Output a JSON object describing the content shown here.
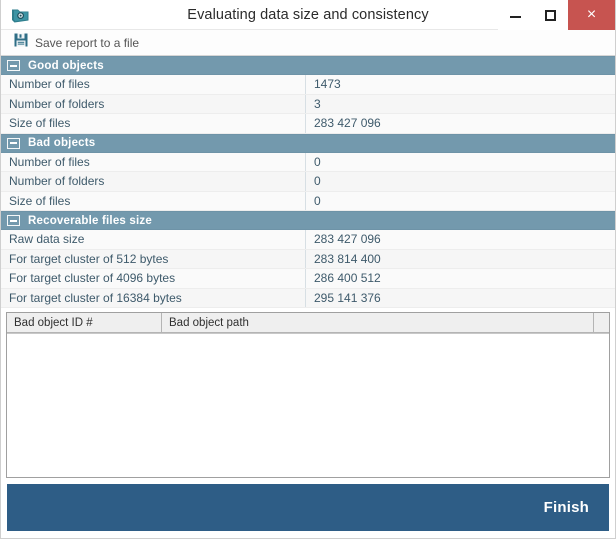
{
  "window": {
    "title": "Evaluating data size and consistency",
    "app_icon": "folder-shield-icon",
    "controls": {
      "minimize_label": "–",
      "maximize_label": "□",
      "close_label": "×",
      "close_color": "#c75450"
    }
  },
  "toolbar": {
    "save_icon": "floppy-disk-icon",
    "save_label": "Save report to a file"
  },
  "colors": {
    "section_header_bg": "#7399ad",
    "footer_bar_bg": "#2e5d86",
    "value_text": "#3e5a6b"
  },
  "sections": [
    {
      "toggle": "collapse-minus-icon",
      "title": "Good objects",
      "rows": [
        {
          "name": "Number of files",
          "value": "1473"
        },
        {
          "name": "Number of folders",
          "value": "3"
        },
        {
          "name": "Size of files",
          "value": "283 427 096"
        }
      ]
    },
    {
      "toggle": "collapse-minus-icon",
      "title": "Bad objects",
      "rows": [
        {
          "name": "Number of files",
          "value": "0"
        },
        {
          "name": "Number of folders",
          "value": "0"
        },
        {
          "name": "Size of files",
          "value": "0"
        }
      ]
    },
    {
      "toggle": "collapse-minus-icon",
      "title": "Recoverable files size",
      "rows": [
        {
          "name": "Raw data size",
          "value": "283 427 096"
        },
        {
          "name": "For target cluster of 512 bytes",
          "value": "283 814 400"
        },
        {
          "name": "For target cluster of 4096 bytes",
          "value": "286 400 512"
        },
        {
          "name": "For target cluster of 16384 bytes",
          "value": "295 141 376"
        }
      ]
    }
  ],
  "bad_objects_table": {
    "columns": [
      {
        "label": "Bad object ID #"
      },
      {
        "label": "Bad object path"
      }
    ],
    "rows": []
  },
  "footer": {
    "finish_label": "Finish"
  }
}
